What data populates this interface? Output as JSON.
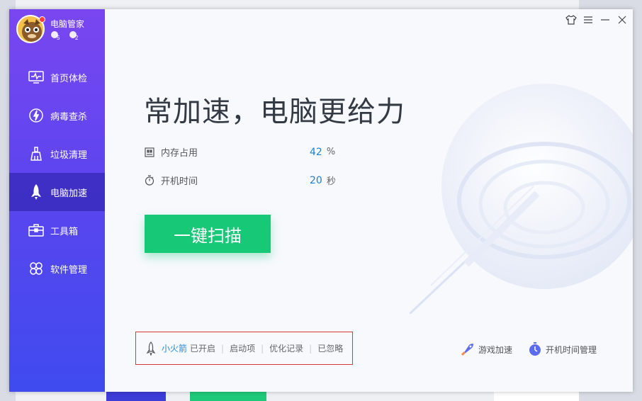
{
  "app": {
    "name": "电脑管家",
    "badges": [
      "5",
      "2"
    ]
  },
  "sidebar": {
    "items": [
      {
        "label": "首页体检",
        "icon": "monitor-pulse-icon"
      },
      {
        "label": "病毒查杀",
        "icon": "lightning-shield-icon"
      },
      {
        "label": "垃圾清理",
        "icon": "broom-icon"
      },
      {
        "label": "电脑加速",
        "icon": "rocket-icon",
        "active": true
      },
      {
        "label": "工具箱",
        "icon": "toolbox-icon"
      },
      {
        "label": "软件管理",
        "icon": "software-icon"
      }
    ]
  },
  "main": {
    "headline": "常加速，电脑更给力",
    "stats": [
      {
        "label": "内存占用",
        "value": "42",
        "unit": "%",
        "icon": "memory-chip-icon"
      },
      {
        "label": "开机时间",
        "value": "20",
        "unit": "秒",
        "icon": "stopwatch-icon"
      }
    ],
    "scan_button": "一键扫描",
    "footer": {
      "rocket_link": "小火箭",
      "rocket_status": "已开启",
      "items": [
        "启动项",
        "优化记录",
        "已忽略"
      ]
    },
    "right_links": [
      {
        "label": "游戏加速",
        "icon": "game-rocket-icon"
      },
      {
        "label": "开机时间管理",
        "icon": "boot-timer-icon"
      }
    ]
  },
  "colors": {
    "accent_green": "#17c977",
    "sidebar_top": "#7a46f0",
    "sidebar_bottom": "#3f4bef",
    "value_blue": "#1f7fd1",
    "link_blue": "#2b8bd6",
    "highlight_red": "#d9363e"
  }
}
